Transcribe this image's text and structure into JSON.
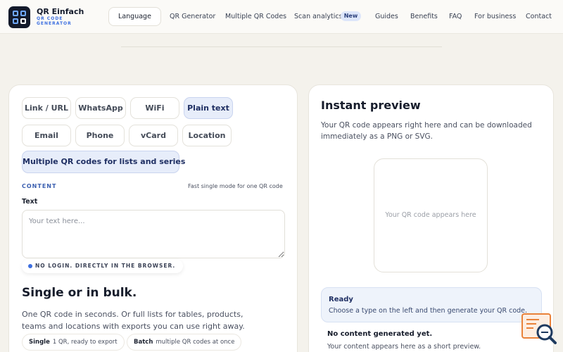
{
  "brand": {
    "name": "QR Einfach",
    "tagline": "QR CODE GENERATOR",
    "accent": "#3d6fe0"
  },
  "header": {
    "language_label": "Language",
    "nav": [
      "QR Generator",
      "Multiple QR Codes",
      "Scan analytics",
      "Guides",
      "Benefits",
      "FAQ",
      "For business",
      "Contact"
    ],
    "new_badge": "New"
  },
  "types": {
    "items": [
      "Link / URL",
      "WhatsApp",
      "WiFi",
      "Plain text",
      "Email",
      "Phone",
      "vCard",
      "Location",
      "Multiple QR codes for lists and series"
    ],
    "selected": "Plain text"
  },
  "content": {
    "section_label": "CONTENT",
    "mode_hint": "Fast single mode for one QR code",
    "text_label": "Text",
    "text_placeholder": "Your text here...",
    "text_value": "",
    "no_login": "NO LOGIN. DIRECTLY IN THE BROWSER."
  },
  "bulk": {
    "title": "Single or in bulk.",
    "description": "One QR code in seconds. Or full lists for tables, products, teams and locations with exports you can use right away.",
    "single_label": "Single",
    "single_desc": "1 QR, ready to export",
    "batch_label": "Batch",
    "batch_desc": "multiple QR codes at once"
  },
  "preview": {
    "title": "Instant preview",
    "description": "Your QR code appears right here and can be downloaded immediately as a PNG or SVG.",
    "placeholder": "Your QR code appears here",
    "ready_title": "Ready",
    "ready_desc": "Choose a type on the left and then generate your QR code.",
    "empty_title": "No content generated yet.",
    "empty_desc": "Your content appears here as a short preview."
  }
}
